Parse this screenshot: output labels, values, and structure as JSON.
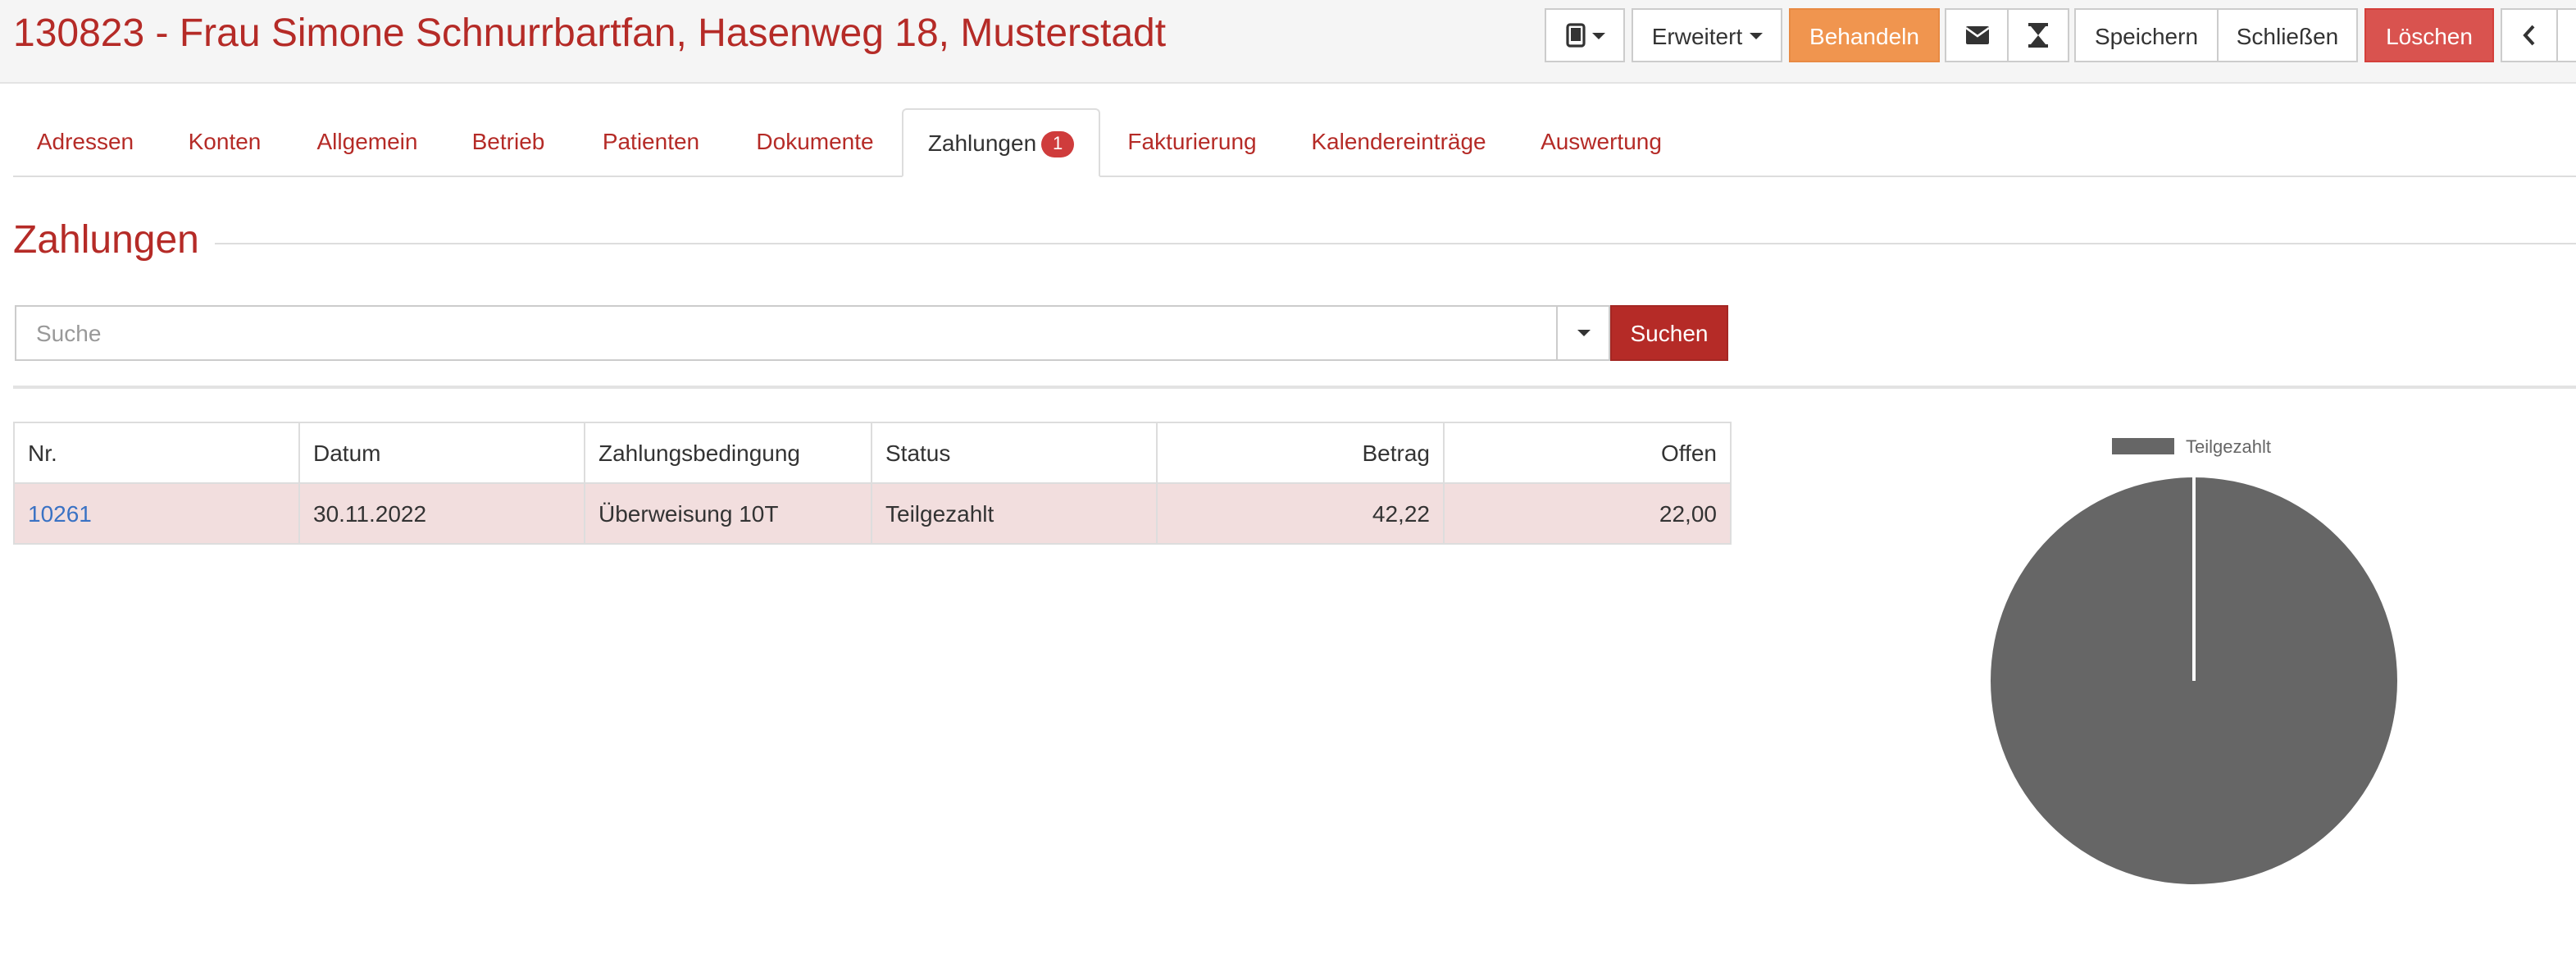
{
  "header": {
    "title": "130823 - Frau Simone Schnurrbartfan, Hasenweg 18, Musterstadt",
    "device_icon": "tablet-icon",
    "buttons": {
      "erweitert": "Erweitert",
      "behandeln": "Behandeln",
      "mail_icon": "envelope-icon",
      "timer_icon": "hourglass-icon",
      "speichern": "Speichern",
      "schliessen": "Schließen",
      "loeschen": "Löschen",
      "back_icon": "chevron-left-icon"
    }
  },
  "tabs": [
    {
      "label": "Adressen"
    },
    {
      "label": "Konten"
    },
    {
      "label": "Allgemein"
    },
    {
      "label": "Betrieb"
    },
    {
      "label": "Patienten"
    },
    {
      "label": "Dokumente"
    },
    {
      "label": "Zahlungen",
      "badge": "1",
      "active": true
    },
    {
      "label": "Fakturierung"
    },
    {
      "label": "Kalendereinträge"
    },
    {
      "label": "Auswertung"
    }
  ],
  "section": {
    "title": "Zahlungen"
  },
  "search": {
    "placeholder": "Suche",
    "value": "",
    "button": "Suchen"
  },
  "table": {
    "columns": [
      "Nr.",
      "Datum",
      "Zahlungsbedingung",
      "Status",
      "Betrag",
      "Offen"
    ],
    "rows": [
      {
        "nr": "10261",
        "datum": "30.11.2022",
        "bedingung": "Überweisung 10T",
        "status": "Teilgezahlt",
        "betrag": "42,22",
        "offen": "22,00"
      }
    ]
  },
  "colors": {
    "brand": "#b52b27",
    "orange": "#f0954f",
    "danger": "#d9534f",
    "row_highlight": "#f2dede",
    "pie": "#666666"
  },
  "chart_data": {
    "type": "pie",
    "title": "",
    "legend": "top",
    "slices": [
      {
        "label": "Teilgezahlt",
        "value": 1,
        "color": "#666666"
      }
    ]
  }
}
